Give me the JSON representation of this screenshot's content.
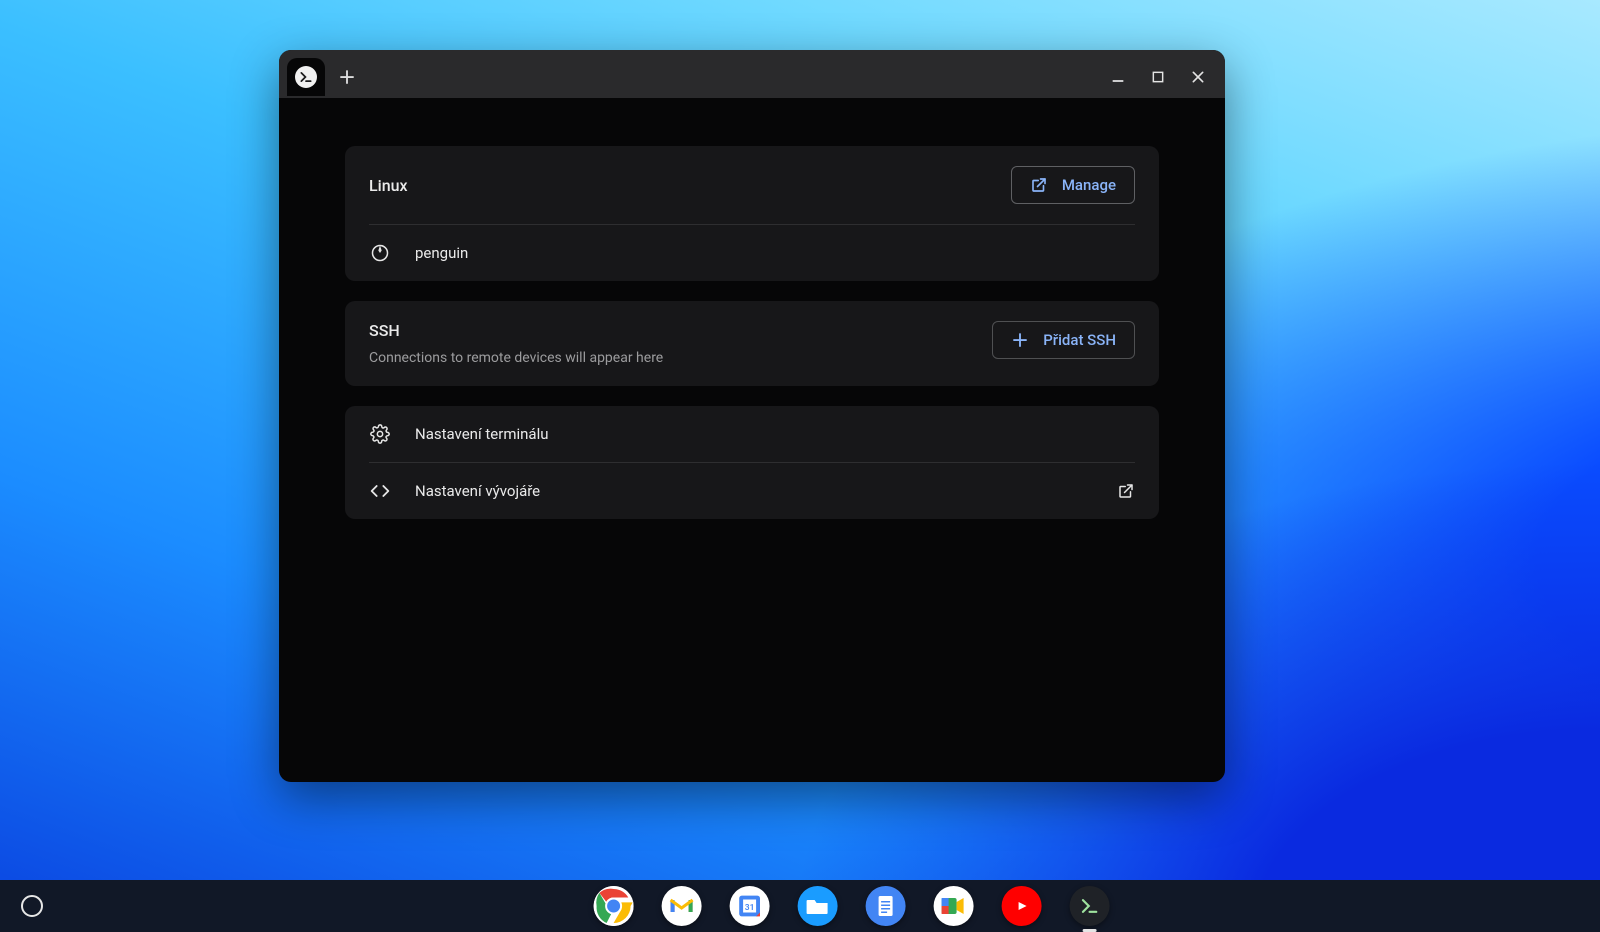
{
  "linux": {
    "title": "Linux",
    "manage_label": "Manage",
    "container_name": "penguin"
  },
  "ssh": {
    "title": "SSH",
    "add_label": "Přidat SSH",
    "empty_hint": "Connections to remote devices will appear here"
  },
  "settings": {
    "terminal_settings_label": "Nastavení terminálu",
    "developer_settings_label": "Nastavení vývojáře"
  },
  "shelf": {
    "apps": [
      "chrome",
      "gmail",
      "calendar",
      "files",
      "docs",
      "meet",
      "youtube",
      "terminal"
    ]
  }
}
